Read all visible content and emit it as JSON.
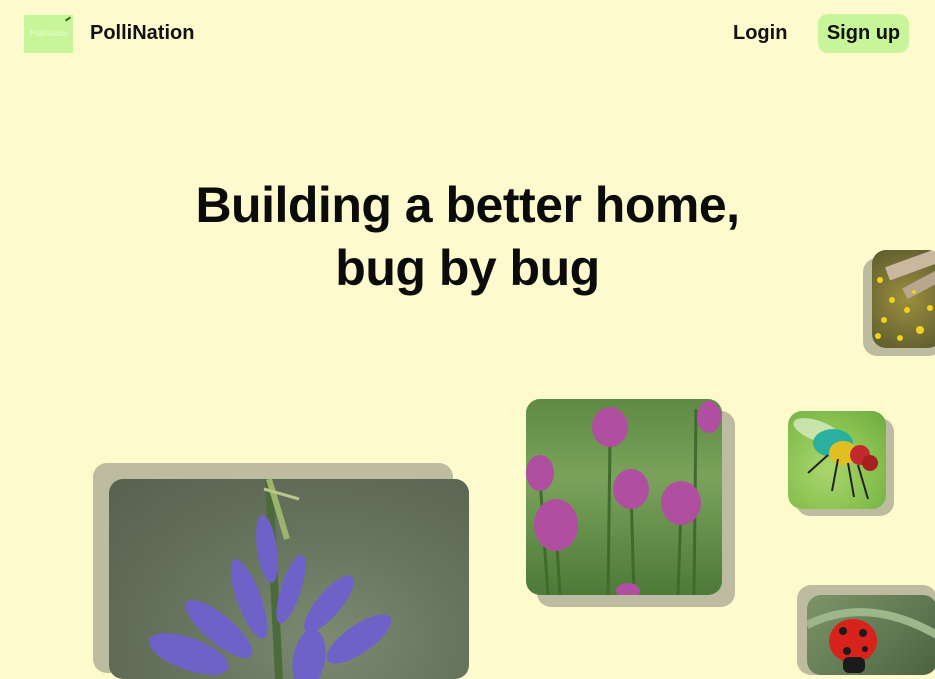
{
  "header": {
    "logo_text": "PolliNation",
    "brand": "PolliNation",
    "login_label": "Login",
    "signup_label": "Sign up"
  },
  "hero": {
    "line1": "Building a better home,",
    "line2": "bug by bug"
  },
  "colors": {
    "background": "#fdfbcd",
    "accent": "#c8f59a",
    "text": "#111111"
  },
  "images": [
    {
      "subject": "purple camas flower"
    },
    {
      "subject": "purple clover flowers in grass"
    },
    {
      "subject": "green metallic fly on leaf"
    },
    {
      "subject": "red ladybug on leaf"
    },
    {
      "subject": "yellow wildflower meadow"
    }
  ]
}
